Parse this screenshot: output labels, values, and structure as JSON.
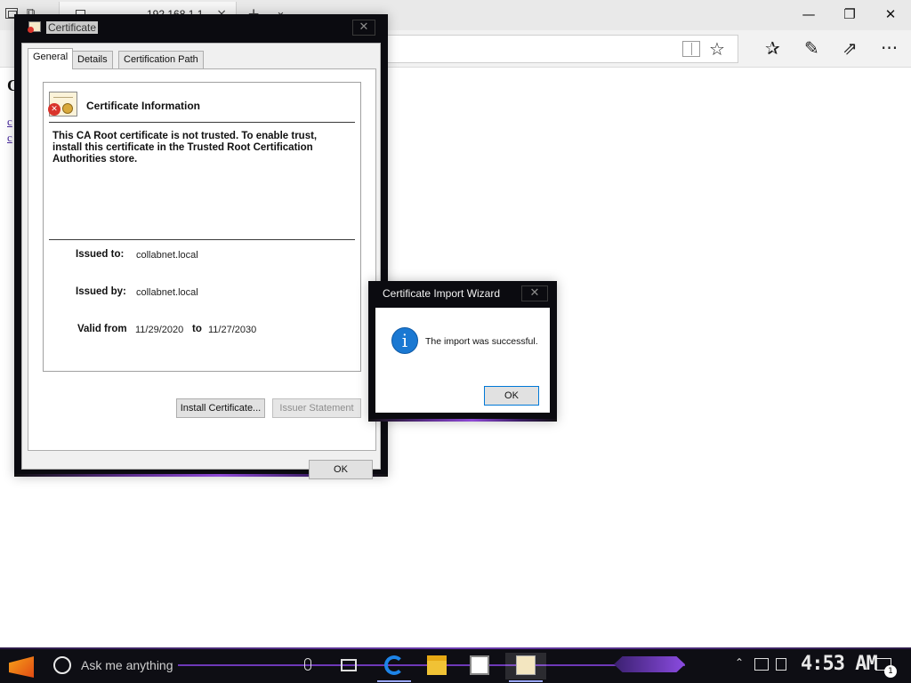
{
  "browser": {
    "tab_title": "192.168.1.1",
    "tab_close": "×",
    "new_tab": "+",
    "tab_dropdown": "⌄",
    "window_controls": {
      "minimize": "—",
      "maximize": "❐",
      "close": "✕"
    },
    "toolbar_icons": [
      "reading-view-icon",
      "favorite-star-icon",
      "favorites-hub-icon",
      "web-note-icon",
      "share-icon",
      "more-icon"
    ],
    "toolbar_glyphs": {
      "star": "☆",
      "hub": "✰",
      "pen": "✎",
      "share": "⇗",
      "more": "···"
    }
  },
  "page": {
    "heading_letter": "C",
    "links": [
      "c",
      "c"
    ]
  },
  "certificate_dialog": {
    "title": "Certificate",
    "close": "✕",
    "tabs": [
      {
        "label": "General",
        "active": true
      },
      {
        "label": "Details",
        "active": false
      },
      {
        "label": "Certification Path",
        "active": false
      }
    ],
    "info_heading": "Certificate Information",
    "trust_message": "This CA Root certificate is not trusted. To enable trust, install this certificate in the Trusted Root Certification Authorities store.",
    "issued_to_label": "Issued to:",
    "issued_to_value": "collabnet.local",
    "issued_by_label": "Issued by:",
    "issued_by_value": "collabnet.local",
    "valid_from_label": "Valid from",
    "valid_from_value": "11/29/2020",
    "valid_to_label": "to",
    "valid_to_value": "11/27/2030",
    "install_button": "Install Certificate...",
    "issuer_statement_button": "Issuer Statement",
    "ok_button": "OK"
  },
  "import_wizard": {
    "title": "Certificate Import Wizard",
    "close": "✕",
    "info_glyph": "i",
    "message": "The import was successful.",
    "ok_button": "OK"
  },
  "taskbar": {
    "search_placeholder": "Ask me anything",
    "clock": "4:53 AM",
    "notification_count": "1",
    "tray_chevron": "⌃",
    "colors": {
      "accent": "#6e38b8",
      "background": "#0e0e14"
    }
  }
}
